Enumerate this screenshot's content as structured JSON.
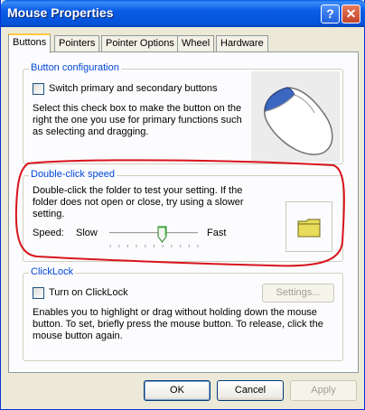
{
  "window": {
    "title": "Mouse Properties"
  },
  "titlebar": {
    "help_label": "?",
    "close_label": "✕"
  },
  "tabs": [
    {
      "label": "Buttons",
      "active": true
    },
    {
      "label": "Pointers"
    },
    {
      "label": "Pointer Options"
    },
    {
      "label": "Wheel"
    },
    {
      "label": "Hardware"
    }
  ],
  "button_config": {
    "title": "Button configuration",
    "checkbox_label": "Switch primary and secondary buttons",
    "checked": false,
    "desc_lines": [
      "Select this check box to make the button on the",
      "right the one you use for primary functions such",
      "as selecting and dragging."
    ]
  },
  "double_click": {
    "title": "Double-click speed",
    "desc_lines": [
      "Double-click the folder to test your setting. If the",
      "folder does not open or close, try using a slower",
      "setting."
    ],
    "speed_label": "Speed:",
    "slow_label": "Slow",
    "fast_label": "Fast",
    "slider_value": 0.6
  },
  "clicklock": {
    "title": "ClickLock",
    "checkbox_label": "Turn on ClickLock",
    "checked": false,
    "settings_label": "Settings...",
    "desc_lines": [
      "Enables you to highlight or drag without holding down the mouse",
      "button. To set, briefly press the mouse button. To release, click the",
      "mouse button again."
    ]
  },
  "footer": {
    "ok_label": "OK",
    "cancel_label": "Cancel",
    "apply_label": "Apply"
  },
  "colors": {
    "annotation": "#d8141c",
    "group_title": "#0046d5",
    "titlebar": "#0a5ce6"
  }
}
